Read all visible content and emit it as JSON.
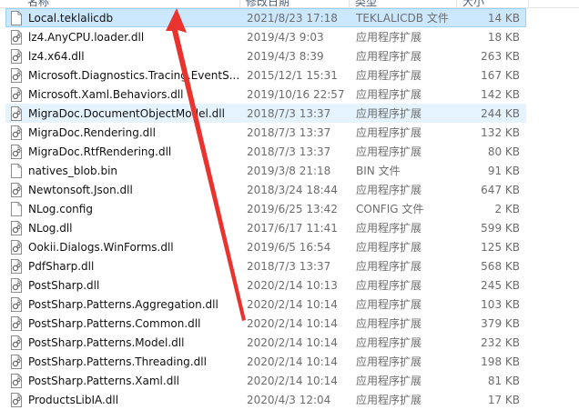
{
  "header": {
    "name": "名称",
    "date": "修改日期",
    "type": "类型",
    "size": "大小"
  },
  "files": [
    {
      "name": "Local.teklalicdb",
      "date": "2021/8/23 17:18",
      "type": "TEKLALICDB 文件",
      "size": "14 KB",
      "icon": "plain-file-icon",
      "state": "selected"
    },
    {
      "name": "lz4.AnyCPU.loader.dll",
      "date": "2019/4/3 9:03",
      "type": "应用程序扩展",
      "size": "18 KB",
      "icon": "dll-file-icon",
      "state": ""
    },
    {
      "name": "lz4.x64.dll",
      "date": "2019/4/3 8:39",
      "type": "应用程序扩展",
      "size": "263 KB",
      "icon": "dll-file-icon",
      "state": ""
    },
    {
      "name": "Microsoft.Diagnostics.Tracing.EventS...",
      "date": "2015/12/1 15:31",
      "type": "应用程序扩展",
      "size": "167 KB",
      "icon": "dll-file-icon",
      "state": ""
    },
    {
      "name": "Microsoft.Xaml.Behaviors.dll",
      "date": "2019/10/16 22:57",
      "type": "应用程序扩展",
      "size": "142 KB",
      "icon": "dll-file-icon",
      "state": ""
    },
    {
      "name": "MigraDoc.DocumentObjectModel.dll",
      "date": "2018/7/3 13:37",
      "type": "应用程序扩展",
      "size": "244 KB",
      "icon": "dll-file-icon",
      "state": "hover"
    },
    {
      "name": "MigraDoc.Rendering.dll",
      "date": "2018/7/3 13:37",
      "type": "应用程序扩展",
      "size": "132 KB",
      "icon": "dll-file-icon",
      "state": ""
    },
    {
      "name": "MigraDoc.RtfRendering.dll",
      "date": "2018/7/3 13:37",
      "type": "应用程序扩展",
      "size": "80 KB",
      "icon": "dll-file-icon",
      "state": ""
    },
    {
      "name": "natives_blob.bin",
      "date": "2019/3/8 21:18",
      "type": "BIN 文件",
      "size": "91 KB",
      "icon": "plain-file-icon",
      "state": ""
    },
    {
      "name": "Newtonsoft.Json.dll",
      "date": "2018/3/24 18:44",
      "type": "应用程序扩展",
      "size": "647 KB",
      "icon": "dll-file-icon",
      "state": ""
    },
    {
      "name": "NLog.config",
      "date": "2019/6/25 13:42",
      "type": "CONFIG 文件",
      "size": "2 KB",
      "icon": "plain-file-icon",
      "state": ""
    },
    {
      "name": "NLog.dll",
      "date": "2017/6/17 11:41",
      "type": "应用程序扩展",
      "size": "599 KB",
      "icon": "dll-file-icon",
      "state": ""
    },
    {
      "name": "Ookii.Dialogs.WinForms.dll",
      "date": "2019/6/5 16:54",
      "type": "应用程序扩展",
      "size": "125 KB",
      "icon": "dll-file-icon",
      "state": ""
    },
    {
      "name": "PdfSharp.dll",
      "date": "2018/7/3 13:37",
      "type": "应用程序扩展",
      "size": "568 KB",
      "icon": "dll-file-icon",
      "state": ""
    },
    {
      "name": "PostSharp.dll",
      "date": "2020/2/14 10:13",
      "type": "应用程序扩展",
      "size": "245 KB",
      "icon": "dll-file-icon",
      "state": ""
    },
    {
      "name": "PostSharp.Patterns.Aggregation.dll",
      "date": "2020/2/14 10:14",
      "type": "应用程序扩展",
      "size": "103 KB",
      "icon": "dll-file-icon",
      "state": ""
    },
    {
      "name": "PostSharp.Patterns.Common.dll",
      "date": "2020/2/14 10:14",
      "type": "应用程序扩展",
      "size": "379 KB",
      "icon": "dll-file-icon",
      "state": ""
    },
    {
      "name": "PostSharp.Patterns.Model.dll",
      "date": "2020/2/14 10:14",
      "type": "应用程序扩展",
      "size": "232 KB",
      "icon": "dll-file-icon",
      "state": ""
    },
    {
      "name": "PostSharp.Patterns.Threading.dll",
      "date": "2020/2/14 10:14",
      "type": "应用程序扩展",
      "size": "198 KB",
      "icon": "dll-file-icon",
      "state": ""
    },
    {
      "name": "PostSharp.Patterns.Xaml.dll",
      "date": "2020/2/14 10:14",
      "type": "应用程序扩展",
      "size": "81 KB",
      "icon": "dll-file-icon",
      "state": ""
    },
    {
      "name": "ProductsLibIA.dll",
      "date": "2020/4/3 12:04",
      "type": "应用程序扩展",
      "size": "17 KB",
      "icon": "dll-file-icon",
      "state": ""
    }
  ],
  "colors": {
    "selected_bg": "#cce8ff",
    "hover_bg": "#e5f3ff",
    "annotation_arrow": "#e8332f"
  }
}
